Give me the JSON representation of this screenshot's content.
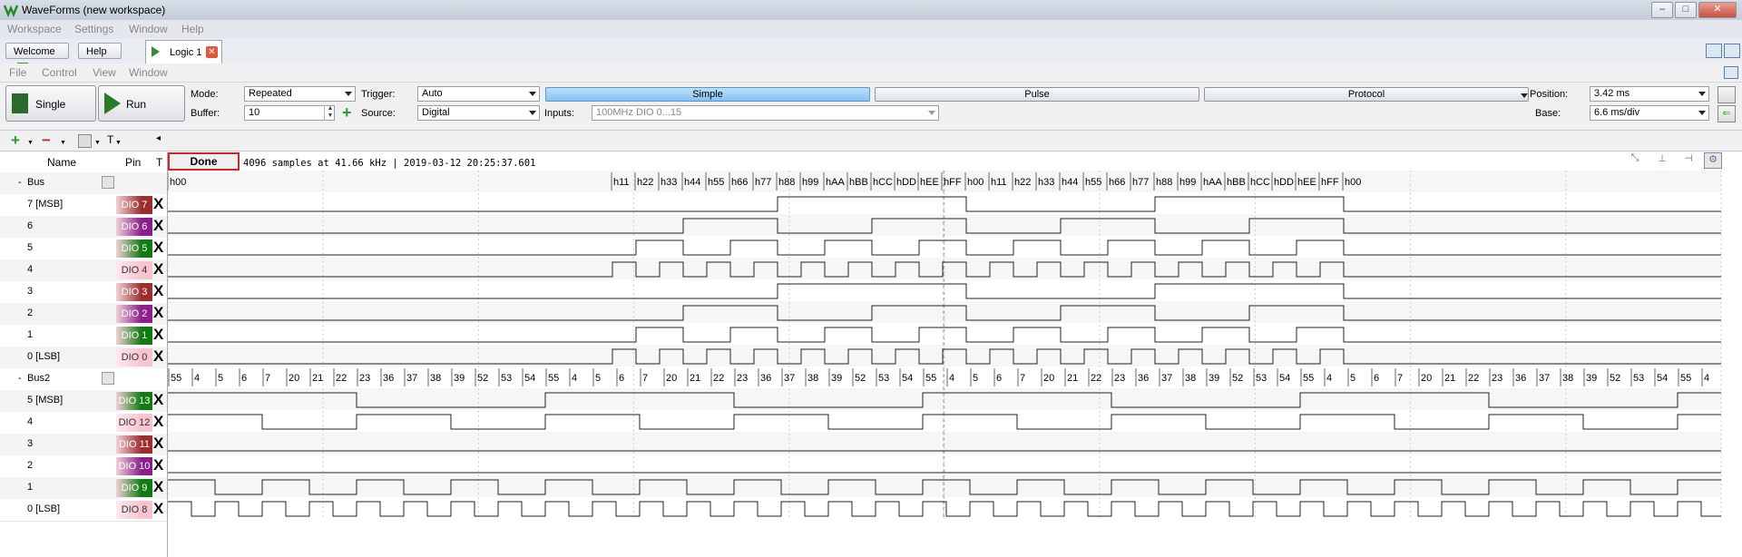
{
  "window": {
    "title": "WaveForms (new workspace)"
  },
  "menubar_top": [
    "Workspace",
    "Settings",
    "Window",
    "Help"
  ],
  "tabs": {
    "welcome": "Welcome",
    "help": "Help",
    "logic": "Logic 1"
  },
  "menubar_instrument": [
    "File",
    "Control",
    "View",
    "Window"
  ],
  "toolbar": {
    "single": "Single",
    "run": "Run",
    "mode_label": "Mode:",
    "mode_value": "Repeated",
    "buffer_label": "Buffer:",
    "buffer_value": "10",
    "trigger_label": "Trigger:",
    "trigger_value": "Auto",
    "source_label": "Source:",
    "source_value": "Digital",
    "inputs_label": "Inputs:",
    "inputs_value": "100MHz DIO 0...15",
    "simple": "Simple",
    "pulse": "Pulse",
    "protocol": "Protocol",
    "position_label": "Position:",
    "position_value": "3.42 ms",
    "base_label": "Base:",
    "base_value": "6.6 ms/div"
  },
  "subtoolbar": {
    "add": "+",
    "remove": "−",
    "trigger_menu": "T",
    "scroll": "|||"
  },
  "columns": {
    "name": "Name",
    "pin": "Pin",
    "t": "T"
  },
  "status": {
    "state": "Done",
    "info": "4096 samples at 41.66 kHz | 2019-03-12 20:25:37.601"
  },
  "colors": {
    "dio7": "#9b2d2d",
    "dio6": "#8a1f8a",
    "dio5": "#127a12",
    "dio4": "#f6c4cf",
    "accent_blue": "#4a9be0"
  },
  "bus1": {
    "name": "Bus",
    "values": [
      "h00",
      "h11",
      "h22",
      "h33",
      "h44",
      "h55",
      "h66",
      "h77",
      "h88",
      "h99",
      "hAA",
      "hBB",
      "hCC",
      "hDD",
      "hEE",
      "hFF",
      "h00",
      "h11",
      "h22",
      "h33",
      "h44",
      "h55",
      "h66",
      "h77",
      "h88",
      "h99",
      "hAA",
      "hBB",
      "hCC",
      "hDD",
      "hEE",
      "hFF",
      "h00"
    ],
    "channels": [
      {
        "label": "7 [MSB]",
        "pin": "DIO 7",
        "color": "#9b2d2d",
        "bit": 7
      },
      {
        "label": "6",
        "pin": "DIO 6",
        "color": "#8a1f8a",
        "bit": 6
      },
      {
        "label": "5",
        "pin": "DIO 5",
        "color": "#127a12",
        "bit": 5
      },
      {
        "label": "4",
        "pin": "DIO 4",
        "color": "#f6c4cf",
        "bit": 4
      },
      {
        "label": "3",
        "pin": "DIO 3",
        "color": "#9b2d2d",
        "bit": 3
      },
      {
        "label": "2",
        "pin": "DIO 2",
        "color": "#8a1f8a",
        "bit": 2
      },
      {
        "label": "1",
        "pin": "DIO 1",
        "color": "#127a12",
        "bit": 1
      },
      {
        "label": "0 [LSB]",
        "pin": "DIO 0",
        "color": "#f6c4cf",
        "bit": 0
      }
    ]
  },
  "bus2": {
    "name": "Bus2",
    "values": [
      "55",
      "4",
      "5",
      "6",
      "7",
      "20",
      "21",
      "22",
      "23",
      "36",
      "37",
      "38",
      "39",
      "52",
      "53",
      "54",
      "55",
      "4",
      "5",
      "6",
      "7",
      "20",
      "21",
      "22",
      "23",
      "36",
      "37",
      "38",
      "39",
      "52",
      "53",
      "54",
      "55",
      "4",
      "5",
      "6",
      "7",
      "20",
      "21",
      "22",
      "23",
      "36",
      "37",
      "38",
      "39",
      "52",
      "53",
      "54",
      "55",
      "4",
      "5",
      "6",
      "7",
      "20",
      "21",
      "22",
      "23",
      "36",
      "37",
      "38",
      "39",
      "52",
      "53",
      "54",
      "55",
      "4"
    ],
    "channels": [
      {
        "label": "5 [MSB]",
        "pin": "DIO 13",
        "color": "#127a12"
      },
      {
        "label": "4",
        "pin": "DIO 12",
        "color": "#f6c4cf"
      },
      {
        "label": "3",
        "pin": "DIO 11",
        "color": "#9b2d2d"
      },
      {
        "label": "2",
        "pin": "DIO 10",
        "color": "#8a1f8a"
      },
      {
        "label": "1",
        "pin": "DIO 9",
        "color": "#127a12"
      },
      {
        "label": "0 [LSB]",
        "pin": "DIO 8",
        "color": "#f6c4cf"
      }
    ]
  },
  "trigger_marker": "X"
}
